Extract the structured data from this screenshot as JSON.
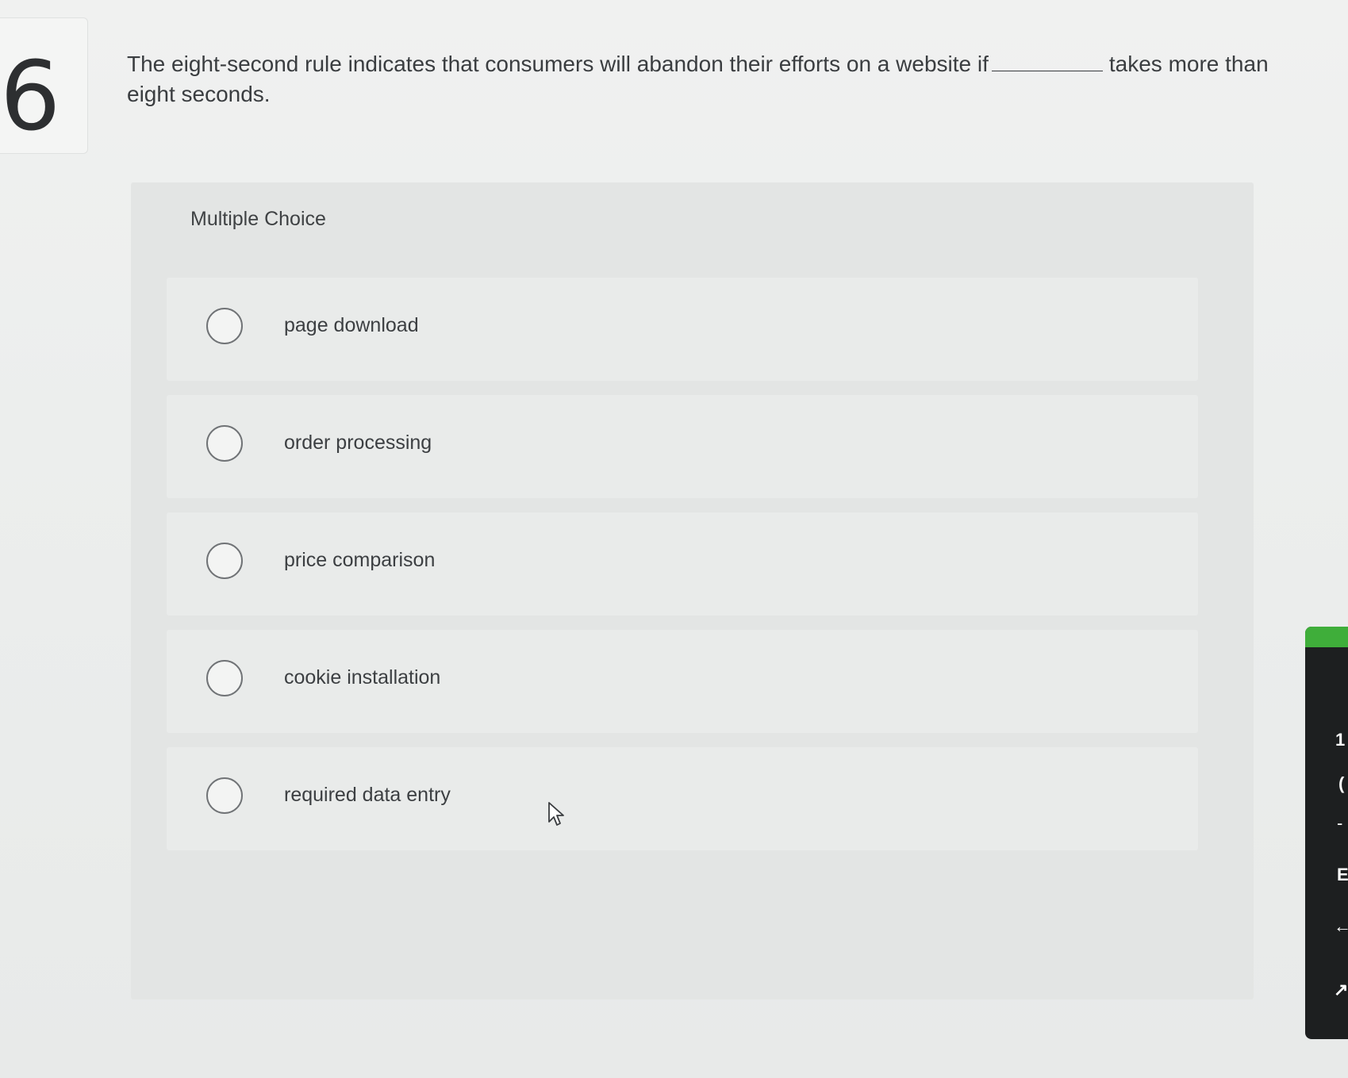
{
  "question": {
    "number": "6",
    "text_before_blank": "The eight-second rule indicates that consumers will abandon their efforts on a website if",
    "text_after_blank": "takes more than eight seconds."
  },
  "multiple_choice": {
    "label": "Multiple Choice",
    "options": [
      {
        "label": "page download",
        "selected": false
      },
      {
        "label": "order processing",
        "selected": false
      },
      {
        "label": "price comparison",
        "selected": false
      },
      {
        "label": "cookie installation",
        "selected": false
      },
      {
        "label": "required data entry",
        "selected": false
      }
    ]
  },
  "side_panel": {
    "accent_color": "#3fae3a",
    "visible_text": [
      "1",
      "(",
      "-",
      "E",
      "←",
      "↗"
    ]
  }
}
